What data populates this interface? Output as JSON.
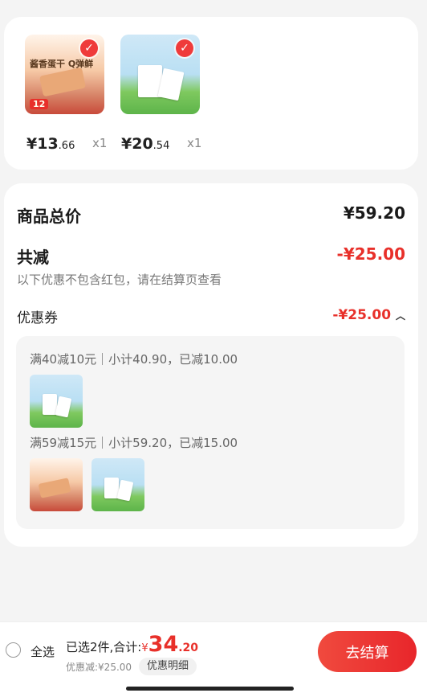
{
  "products": [
    {
      "price_int": "¥13",
      "price_dec": ".66",
      "qty": "x1",
      "image_text": "酱香蛋干 Q弹鲜",
      "image_badge": "12"
    },
    {
      "price_int": "¥20",
      "price_dec": ".54",
      "qty": "x1"
    }
  ],
  "summary": {
    "total_label": "商品总价",
    "total_value": "¥59.20",
    "reduce_label": "共减",
    "reduce_value": "-¥25.00",
    "note": "以下优惠不包含红包，请在结算页查看",
    "coupon_label": "优惠券",
    "coupon_value": "-¥25.00"
  },
  "coupon_groups": [
    {
      "title": "满40减10元｜小计40.90，已减10.00"
    },
    {
      "title": "满59减15元｜小计59.20，已减15.00"
    }
  ],
  "bottom": {
    "select_all": "全选",
    "selected_text": "已选2件,合计:",
    "currency": "¥",
    "total_int": "34",
    "total_dec": ".20",
    "discount_text": "优惠减:¥25.00",
    "detail_button": "优惠明细",
    "checkout_button": "去结算"
  },
  "colors": {
    "accent": "#e8302a",
    "background": "#f4f4f4"
  }
}
